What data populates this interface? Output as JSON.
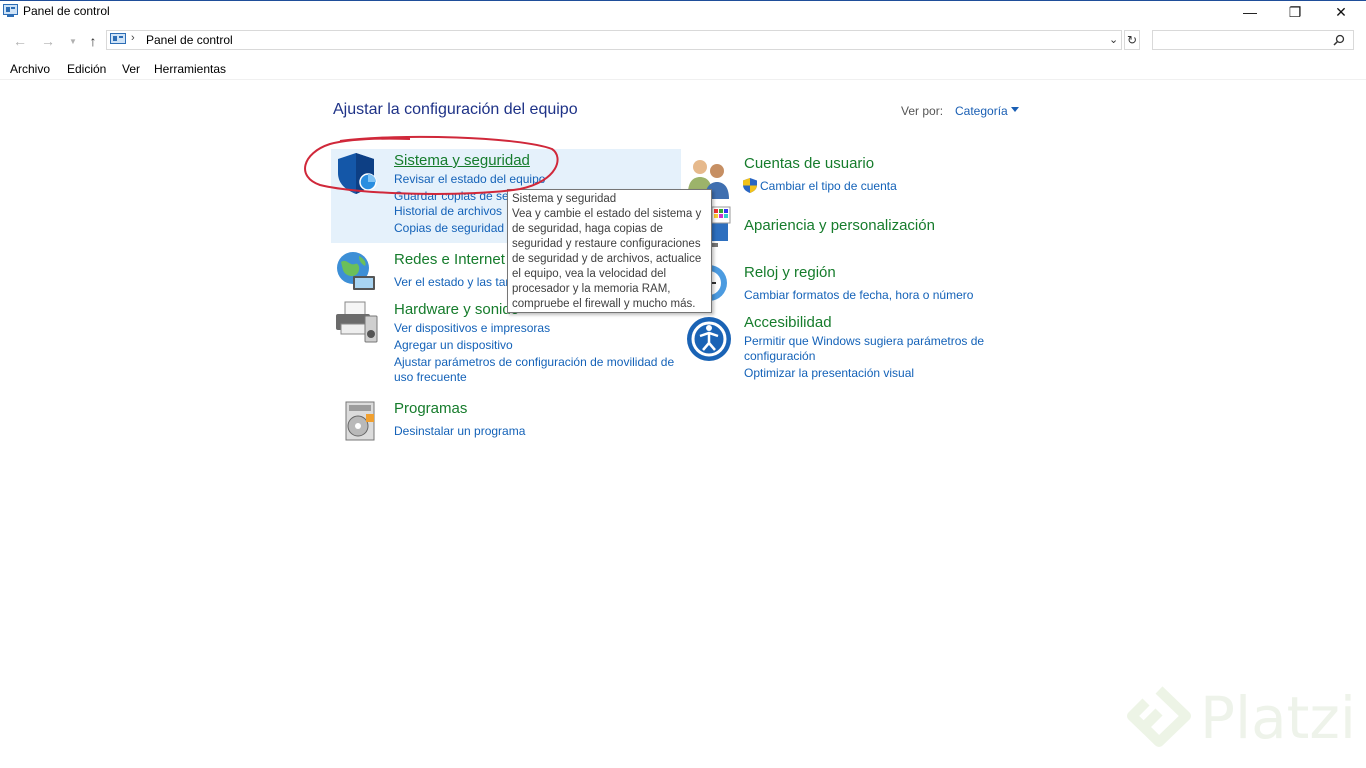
{
  "window": {
    "title": "Panel de control",
    "controls": {
      "minimize": "—",
      "restore": "❐",
      "close": "✕"
    }
  },
  "address": {
    "breadcrumb": "Panel de control",
    "search_placeholder": ""
  },
  "menu": [
    "Archivo",
    "Edición",
    "Ver",
    "Herramientas"
  ],
  "main": {
    "heading": "Ajustar la configuración del equipo",
    "view_by_label": "Ver por:",
    "view_by_value": "Categoría"
  },
  "categories": {
    "sistema": {
      "title": "Sistema y seguridad",
      "links": [
        "Revisar el estado del equipo",
        "Guardar copias de seg",
        "Historial de archivos",
        "Copias de seguridad y"
      ]
    },
    "redes": {
      "title": "Redes e Internet",
      "links": [
        "Ver el estado y las tar"
      ]
    },
    "hardware": {
      "title": "Hardware y sonido",
      "links": [
        "Ver dispositivos e impresoras",
        "Agregar un dispositivo",
        "Ajustar parámetros de configuración de movilidad de",
        "uso frecuente"
      ]
    },
    "programas": {
      "title": "Programas",
      "links": [
        "Desinstalar un programa"
      ]
    },
    "cuentas": {
      "title": "Cuentas de usuario",
      "links": [
        "Cambiar el tipo de cuenta"
      ]
    },
    "apariencia": {
      "title": "Apariencia y personalización",
      "links": []
    },
    "reloj": {
      "title": "Reloj y región",
      "links": [
        "Cambiar formatos de fecha, hora o número"
      ]
    },
    "accesibilidad": {
      "title": "Accesibilidad",
      "links": [
        "Permitir que Windows sugiera parámetros de",
        "configuración",
        "Optimizar la presentación visual"
      ]
    }
  },
  "tooltip": {
    "lines": [
      "Sistema y seguridad",
      "Vea y cambie el estado del sistema y",
      "de seguridad, haga copias de",
      "seguridad y restaure configuraciones",
      "de seguridad y de archivos, actualice",
      "el equipo, vea la velocidad del",
      "procesador y la memoria RAM,",
      "compruebe el firewall y mucho más."
    ]
  },
  "watermark": {
    "text": "Platzi"
  },
  "icons": {
    "sistema": "shield-icon",
    "redes": "globe-network-icon",
    "hardware": "printer-icon",
    "programas": "program-disc-icon",
    "cuentas": "users-icon",
    "apariencia": "color-palette-monitor-icon",
    "reloj": "clock-globe-icon",
    "accesibilidad": "accessibility-icon"
  },
  "colors": {
    "category_title": "#167c2c",
    "link": "#1462b8",
    "heading": "#1e3287",
    "hover_highlight": "#e5f1fb",
    "annotation": "#d0283a"
  }
}
